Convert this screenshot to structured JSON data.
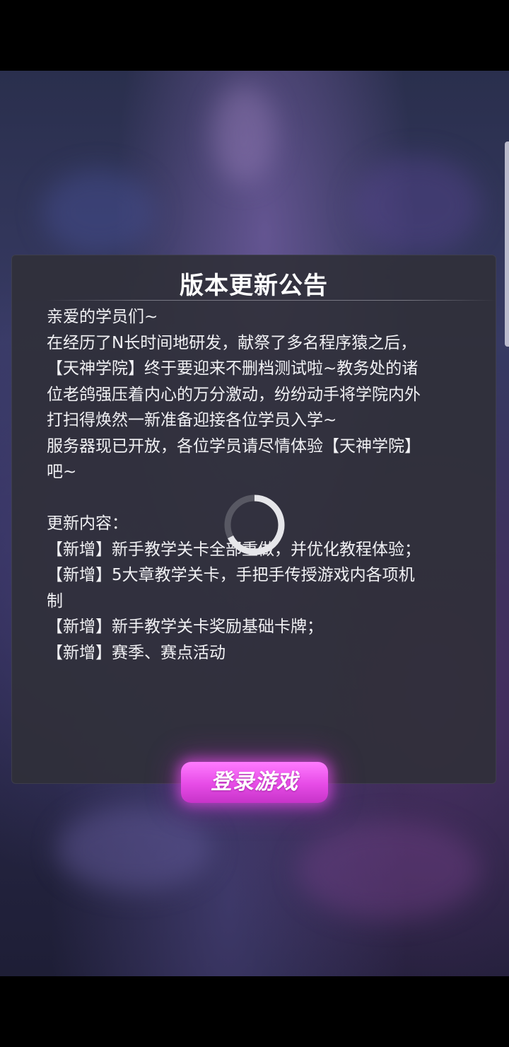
{
  "dialog": {
    "title": "版本更新公告",
    "lines": [
      "亲爱的学员们~",
      "在经历了N长时间地研发，献祭了多名程序猿之后，",
      "【天神学院】终于要迎来不删档测试啦~教务处的诸",
      "位老鸽强压着内心的万分激动，纷纷动手将学院内外",
      "打扫得焕然一新准备迎接各位学员入学~",
      "服务器现已开放，各位学员请尽情体验【天神学院】",
      "吧~",
      "",
      "更新内容：",
      "【新增】新手教学关卡全部重做，并优化教程体验；",
      "【新增】5大章教学关卡，手把手传授游戏内各项机",
      "制",
      "【新增】新手教学关卡奖励基础卡牌；",
      "【新增】赛季、赛点活动"
    ]
  },
  "login_button": {
    "label": "登录游戏"
  },
  "colors": {
    "accent": "#e64be6",
    "panel": "#303038",
    "text": "#f1f1f4"
  },
  "icons": {
    "spinner": "loading-spinner-icon"
  }
}
